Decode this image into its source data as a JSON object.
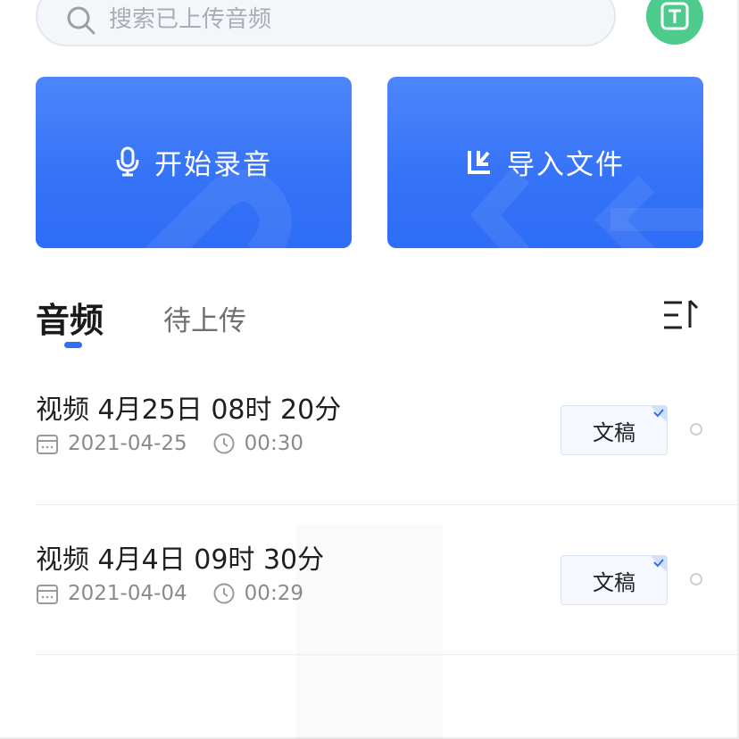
{
  "search": {
    "placeholder": "搜索已上传音频"
  },
  "avatar": {
    "icon": "text-recognition-icon",
    "color": "#4ccb8c"
  },
  "actions": [
    {
      "label": "开始录音",
      "icon": "microphone-icon"
    },
    {
      "label": "导入文件",
      "icon": "import-icon"
    }
  ],
  "tabs": [
    {
      "label": "音频",
      "active": true
    },
    {
      "label": "待上传",
      "active": false
    }
  ],
  "sort": {
    "icon": "sort-icon"
  },
  "accent": "#2f6ff5",
  "items": [
    {
      "title": "视频 4月25日 08时 20分",
      "date": "2021-04-25",
      "duration": "00:30",
      "doc_label": "文稿"
    },
    {
      "title": "视频 4月4日 09时 30分",
      "date": "2021-04-04",
      "duration": "00:29",
      "doc_label": "文稿"
    }
  ]
}
